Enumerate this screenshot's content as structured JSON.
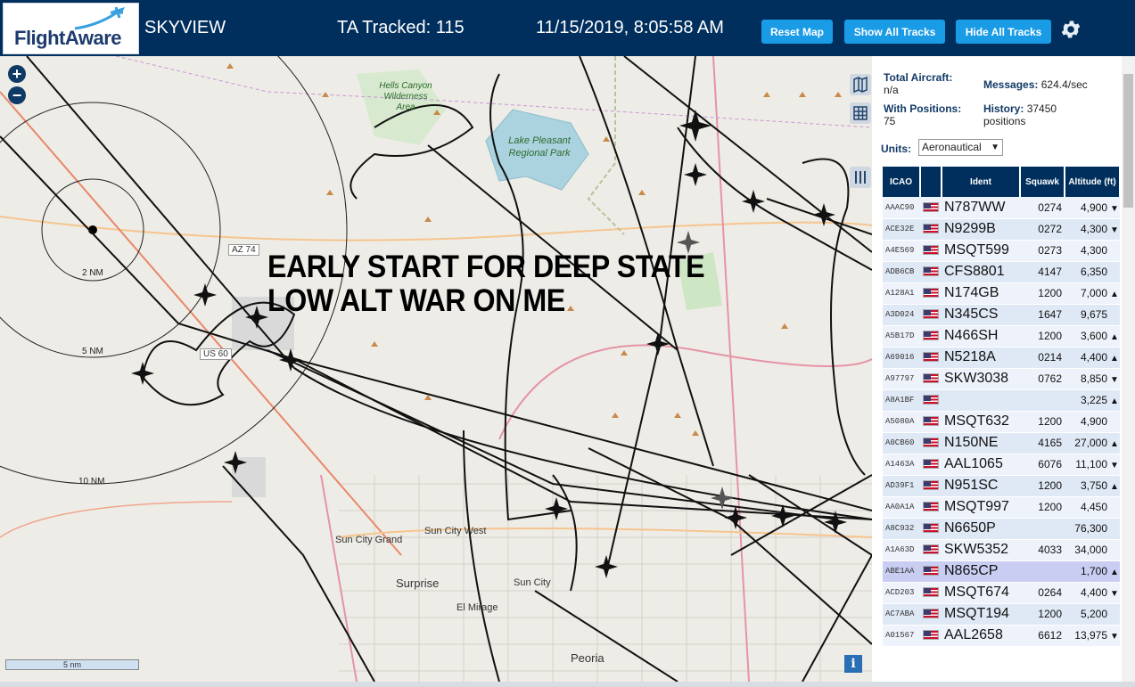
{
  "header": {
    "logo_text": "FlightAware",
    "title": "SKYVIEW",
    "tracked": "TA Tracked: 115",
    "datetime": "11/15/2019, 8:05:58 AM",
    "buttons": {
      "reset": "Reset Map",
      "show_all": "Show All Tracks",
      "hide_all": "Hide All Tracks"
    },
    "settings_icon": "gear-icon"
  },
  "map": {
    "zoom_in": "+",
    "zoom_out": "−",
    "overlay_line1": "EARLY START FOR DEEP STATE",
    "overlay_line2": "LOW ALT WAR ON ME",
    "scale_label": "5 nm",
    "info_icon": "i",
    "range_rings": [
      "2 NM",
      "5 NM",
      "10 NM"
    ],
    "places": [
      "Hells Canyon Wilderness Area",
      "Lake Pleasant Regional Park",
      "Sun City Grand",
      "Sun City West",
      "Sun City",
      "Surprise",
      "El Mirage",
      "Peoria"
    ],
    "roads": [
      "AZ 74",
      "US 60"
    ],
    "colors": {
      "land": "#eeece6",
      "water": "#aad3df",
      "park": "#cde6c4",
      "header": "#002f5d",
      "button": "#1a9be6"
    }
  },
  "sidebar": {
    "total_aircraft_label": "Total Aircraft:",
    "total_aircraft_value": "n/a",
    "messages_label": "Messages:",
    "messages_value": "624.4/sec",
    "with_positions_label": "With Positions:",
    "with_positions_value": "75",
    "history_label": "History:",
    "history_value": "37450",
    "history_unit": "positions",
    "units_label": "Units:",
    "units_value": "Aeronautical",
    "columns": [
      "ICAO",
      "",
      "Ident",
      "Squawk",
      "Altitude (ft)"
    ],
    "rows": [
      {
        "icao": "AAAC90",
        "ident": "N787WW",
        "squawk": "0274",
        "alt": "4,900",
        "trend": "▼"
      },
      {
        "icao": "ACE32E",
        "ident": "N9299B",
        "squawk": "0272",
        "alt": "4,300",
        "trend": "▼"
      },
      {
        "icao": "A4E569",
        "ident": "MSQT599",
        "squawk": "0273",
        "alt": "4,300",
        "trend": ""
      },
      {
        "icao": "ADB6CB",
        "ident": "CFS8801",
        "squawk": "4147",
        "alt": "6,350",
        "trend": ""
      },
      {
        "icao": "A128A1",
        "ident": "N174GB",
        "squawk": "1200",
        "alt": "7,000",
        "trend": "▲"
      },
      {
        "icao": "A3D024",
        "ident": "N345CS",
        "squawk": "1647",
        "alt": "9,675",
        "trend": ""
      },
      {
        "icao": "A5B17D",
        "ident": "N466SH",
        "squawk": "1200",
        "alt": "3,600",
        "trend": "▲"
      },
      {
        "icao": "A69016",
        "ident": "N5218A",
        "squawk": "0214",
        "alt": "4,400",
        "trend": "▲"
      },
      {
        "icao": "A97797",
        "ident": "SKW3038",
        "squawk": "0762",
        "alt": "8,850",
        "trend": "▼"
      },
      {
        "icao": "A8A1BF",
        "ident": "",
        "squawk": "",
        "alt": "3,225",
        "trend": "▲"
      },
      {
        "icao": "A5080A",
        "ident": "MSQT632",
        "squawk": "1200",
        "alt": "4,900",
        "trend": ""
      },
      {
        "icao": "A0CB60",
        "ident": "N150NE",
        "squawk": "4165",
        "alt": "27,000",
        "trend": "▲"
      },
      {
        "icao": "A1463A",
        "ident": "AAL1065",
        "squawk": "6076",
        "alt": "11,100",
        "trend": "▼"
      },
      {
        "icao": "AD39F1",
        "ident": "N951SC",
        "squawk": "1200",
        "alt": "3,750",
        "trend": "▲"
      },
      {
        "icao": "AA0A1A",
        "ident": "MSQT997",
        "squawk": "1200",
        "alt": "4,450",
        "trend": ""
      },
      {
        "icao": "A8C932",
        "ident": "N6650P",
        "squawk": "",
        "alt": "76,300",
        "trend": ""
      },
      {
        "icao": "A1A63D",
        "ident": "SKW5352",
        "squawk": "4033",
        "alt": "34,000",
        "trend": ""
      },
      {
        "icao": "ABE1AA",
        "ident": "N865CP",
        "squawk": "",
        "alt": "1,700",
        "trend": "▲"
      },
      {
        "icao": "ACD203",
        "ident": "MSQT674",
        "squawk": "0264",
        "alt": "4,400",
        "trend": "▼"
      },
      {
        "icao": "AC7ABA",
        "ident": "MSQT194",
        "squawk": "1200",
        "alt": "5,200",
        "trend": ""
      },
      {
        "icao": "A01567",
        "ident": "AAL2658",
        "squawk": "6612",
        "alt": "13,975",
        "trend": "▼"
      }
    ]
  }
}
